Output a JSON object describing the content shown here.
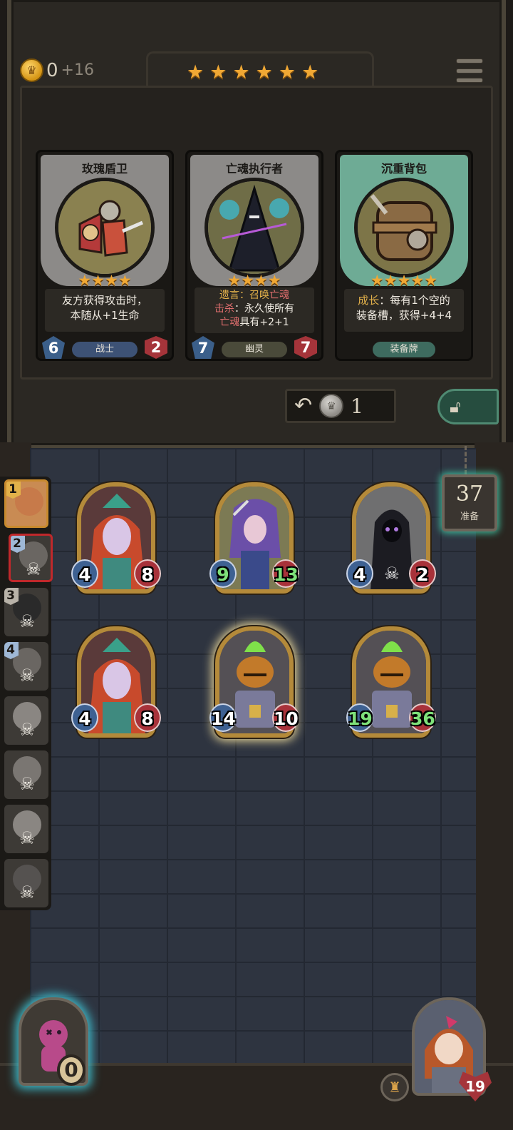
{
  "shop": {
    "gold": "0",
    "gold_income": "+16",
    "tavern_stars": [
      "★",
      "★",
      "★",
      "★",
      "★",
      "★"
    ],
    "refresh_cost": "1",
    "cards": [
      {
        "name": "玫瑰盾卫",
        "stars": "★★★★",
        "desc_line1": "友方获得攻击时，",
        "desc_line2": "本随从+1生命",
        "attack": "6",
        "health": "2",
        "tribe": "战士"
      },
      {
        "name": "亡魂执行者",
        "stars": "★★★★",
        "desc_line1a": "遗言：召唤",
        "desc_line1b": "亡魂",
        "desc_line2a": "击杀",
        "desc_line2b": "：永久使所有",
        "desc_line3a": "亡魂",
        "desc_line3b": "具有+2+1",
        "attack": "7",
        "health": "7",
        "tribe": "幽灵"
      },
      {
        "name": "沉重背包",
        "stars": "★★★★★",
        "desc_line1a": "成长",
        "desc_line1b": "：每有1个空的",
        "desc_line2": "装备槽，获得+4+4",
        "tribe": "装备牌"
      }
    ]
  },
  "board": {
    "minions": [
      {
        "attack": "4",
        "health": "8"
      },
      {
        "attack": "9",
        "health": "13"
      },
      {
        "attack": "4",
        "health": "2"
      },
      {
        "attack": "4",
        "health": "8"
      },
      {
        "attack": "14",
        "health": "10"
      },
      {
        "attack": "19",
        "health": "36"
      }
    ]
  },
  "prep": {
    "count": "37",
    "label": "准备"
  },
  "opponents": [
    {
      "rank": "1"
    },
    {
      "rank": "2"
    },
    {
      "rank": "3"
    },
    {
      "rank": "4"
    }
  ],
  "hud": {
    "hero_power_count": "0",
    "player_health": "19"
  },
  "colors": {
    "gold_star": "#f0a834",
    "attack_blue": "#3e6192",
    "health_red": "#a8323a",
    "buff_green": "#7ee07a",
    "keyword_gold": "#e3b14a",
    "keyword_red": "#e06e6e"
  },
  "icons": {
    "coin": "crown-coin-icon",
    "menu": "hamburger-menu-icon",
    "refresh": "refresh-arrow-icon",
    "lock": "padlock-icon",
    "skull": "skull-icon",
    "tavern": "tavern-upgrade-icon"
  }
}
